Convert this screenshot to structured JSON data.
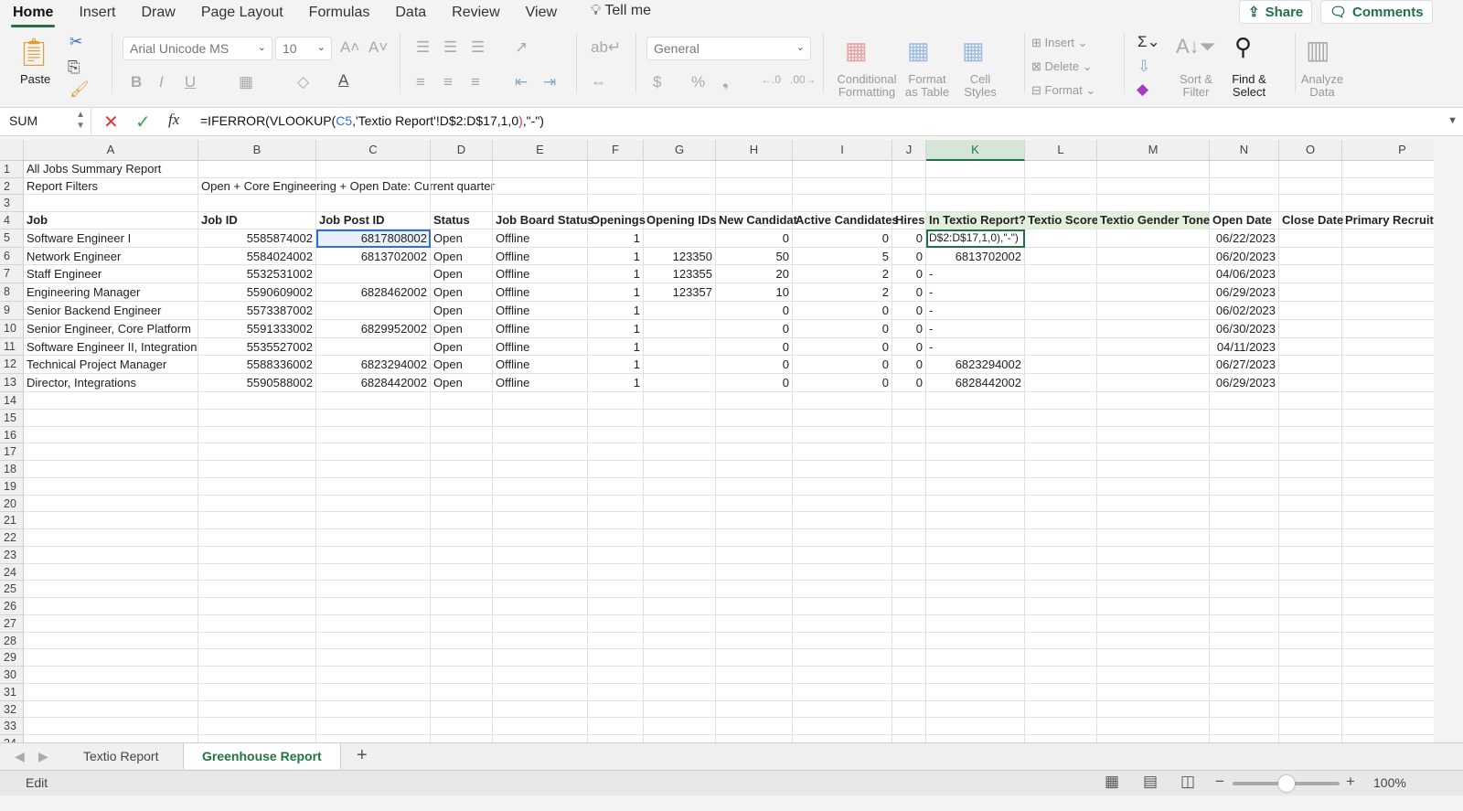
{
  "menu": {
    "tabs": [
      "Home",
      "Insert",
      "Draw",
      "Page Layout",
      "Formulas",
      "Data",
      "Review",
      "View"
    ],
    "tell_me": "Tell me",
    "share": "Share",
    "comments": "Comments"
  },
  "ribbon": {
    "paste": "Paste",
    "font_name": "Arial Unicode MS",
    "font_size": "10",
    "number_format": "General",
    "conditional_formatting": "Conditional Formatting",
    "format_as_table": "Format as Table",
    "cell_styles": "Cell Styles",
    "insert": "Insert",
    "delete": "Delete",
    "format": "Format",
    "sort_filter": "Sort & Filter",
    "find_select": "Find & Select",
    "analyze_data": "Analyze Data"
  },
  "formula_bar": {
    "name_box": "SUM",
    "formula_prefix": "=IFERROR(VLOOKUP(",
    "formula_ref": "C5",
    "formula_mid": ",'Textio Report'!D$2:D$17,1,0",
    ")": ")",
    "formula_paren": ")",
    "formula_suffix": ",\"-\")"
  },
  "columns": [
    "A",
    "B",
    "C",
    "D",
    "E",
    "F",
    "G",
    "H",
    "I",
    "J",
    "K",
    "L",
    "M",
    "N",
    "O",
    "P"
  ],
  "rows": [
    [
      "All Jobs Summary Report"
    ],
    [
      "Report Filters",
      "Open + Core Engineering + Open Date: Current quarter"
    ],
    [],
    [
      "Job",
      "Job ID",
      "Job Post ID",
      "Status",
      "Job Board Status",
      "Openings",
      "Opening IDs",
      "New Candidat",
      "Active Candidates",
      "Hires",
      "In Textio Report?",
      "Textio Score",
      "Textio Gender Tone",
      "Open Date",
      "Close Date",
      "Primary Recruite"
    ],
    [
      "Software Engineer I",
      "5585874002",
      "6817808002",
      "Open",
      "Offline",
      "1",
      "",
      "0",
      "0",
      "0",
      "D$2:D$17,1,0),\"-\")",
      "",
      "",
      "06/22/2023",
      "",
      ""
    ],
    [
      "Network Engineer",
      "5584024002",
      "6813702002",
      "Open",
      "Offline",
      "1",
      "123350",
      "50",
      "5",
      "0",
      "6813702002",
      "",
      "",
      "06/20/2023",
      "",
      ""
    ],
    [
      "Staff Engineer",
      "5532531002",
      "",
      "Open",
      "Offline",
      "1",
      "123355",
      "20",
      "2",
      "0",
      "-",
      "",
      "",
      "04/06/2023",
      "",
      ""
    ],
    [
      "Engineering Manager",
      "5590609002",
      "6828462002",
      "Open",
      "Offline",
      "1",
      "123357",
      "10",
      "2",
      "0",
      "-",
      "",
      "",
      "06/29/2023",
      "",
      ""
    ],
    [
      "Senior Backend Engineer",
      "5573387002",
      "",
      "Open",
      "Offline",
      "1",
      "",
      "0",
      "0",
      "0",
      "-",
      "",
      "",
      "06/02/2023",
      "",
      ""
    ],
    [
      "Senior Engineer, Core Platform",
      "5591333002",
      "6829952002",
      "Open",
      "Offline",
      "1",
      "",
      "0",
      "0",
      "0",
      "-",
      "",
      "",
      "06/30/2023",
      "",
      ""
    ],
    [
      "Software Engineer II, Integration",
      "5535527002",
      "",
      "Open",
      "Offline",
      "1",
      "",
      "0",
      "0",
      "0",
      "-",
      "",
      "",
      "04/11/2023",
      "",
      ""
    ],
    [
      "Technical Project Manager",
      "5588336002",
      "6823294002",
      "Open",
      "Offline",
      "1",
      "",
      "0",
      "0",
      "0",
      "6823294002",
      "",
      "",
      "06/27/2023",
      "",
      ""
    ],
    [
      "Director, Integrations",
      "5590588002",
      "6828442002",
      "Open",
      "Offline",
      "1",
      "",
      "0",
      "0",
      "0",
      "6828442002",
      "",
      "",
      "06/29/2023",
      "",
      ""
    ]
  ],
  "sheets": [
    "Textio Report",
    "Greenhouse Report"
  ],
  "active_sheet": "Greenhouse Report",
  "status": {
    "mode": "Edit",
    "zoom": "100%",
    "zoom_level": 100
  },
  "colors": {
    "accent": "#217346",
    "header_fill": "#e2efda"
  }
}
